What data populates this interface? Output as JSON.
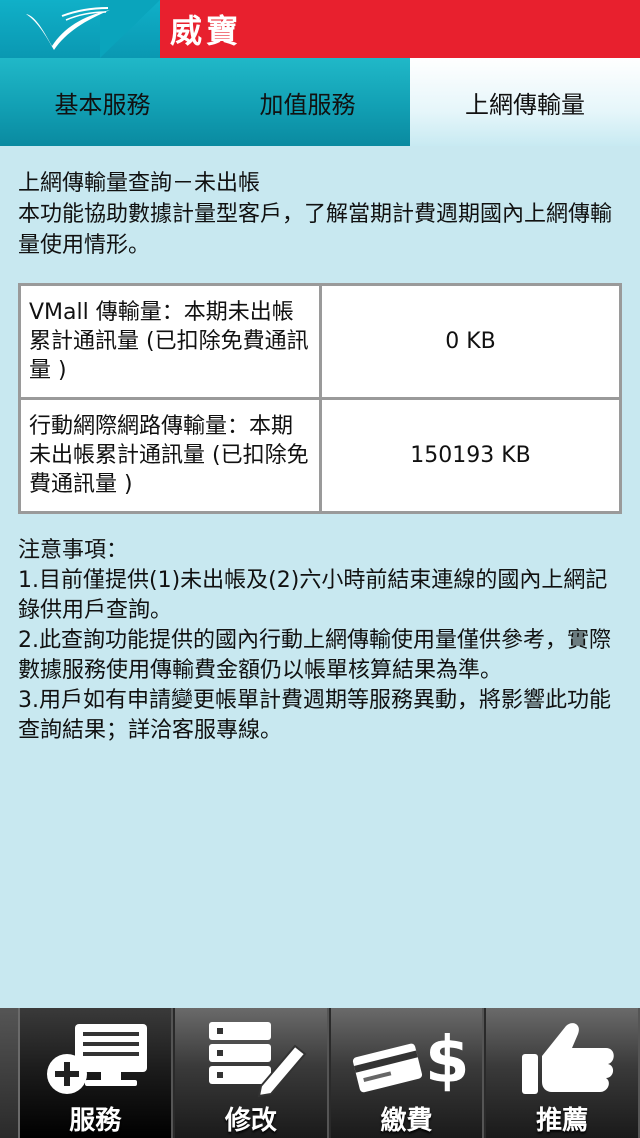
{
  "header": {
    "title": "威寶"
  },
  "tabs": [
    {
      "label": "基本服務"
    },
    {
      "label": "加值服務"
    },
    {
      "label": "上網傳輸量"
    }
  ],
  "intro": {
    "title": "上網傳輸量查詢－未出帳",
    "description": " 本功能協助數據計量型客戶，了解當期計費週期國內上網傳輸量使用情形。"
  },
  "usage_table": {
    "rows": [
      {
        "label": "VMall 傳輸量：本期未出帳累計通訊量 (已扣除免費通訊量 )",
        "value": "0 KB"
      },
      {
        "label": "行動網際網路傳輸量：本期未出帳累計通訊量 (已扣除免費通訊量 )",
        "value": "150193 KB"
      }
    ]
  },
  "notes": {
    "heading": "注意事項：",
    "items": [
      "1.目前僅提供(1)未出帳及(2)六小時前結束連線的國內上網記錄供用戶查詢。",
      "2.此查詢功能提供的國內行動上網傳輸使用量僅供參考，實際數據服務使用傳輸費金額仍以帳單核算結果為準。",
      "3.用戶如有申請變更帳單計費週期等服務異動，將影響此功能查詢結果；詳洽客服專線。"
    ]
  },
  "bottom_nav": [
    {
      "label": "服務",
      "icon": "computer-plus-icon"
    },
    {
      "label": "修改",
      "icon": "edit-list-icon"
    },
    {
      "label": "繳費",
      "icon": "card-dollar-icon"
    },
    {
      "label": "推薦",
      "icon": "thumbs-up-icon"
    }
  ],
  "colors": {
    "header_red": "#e8202e",
    "tab_teal": "#12a0b4",
    "background": "#c8e8f0"
  }
}
